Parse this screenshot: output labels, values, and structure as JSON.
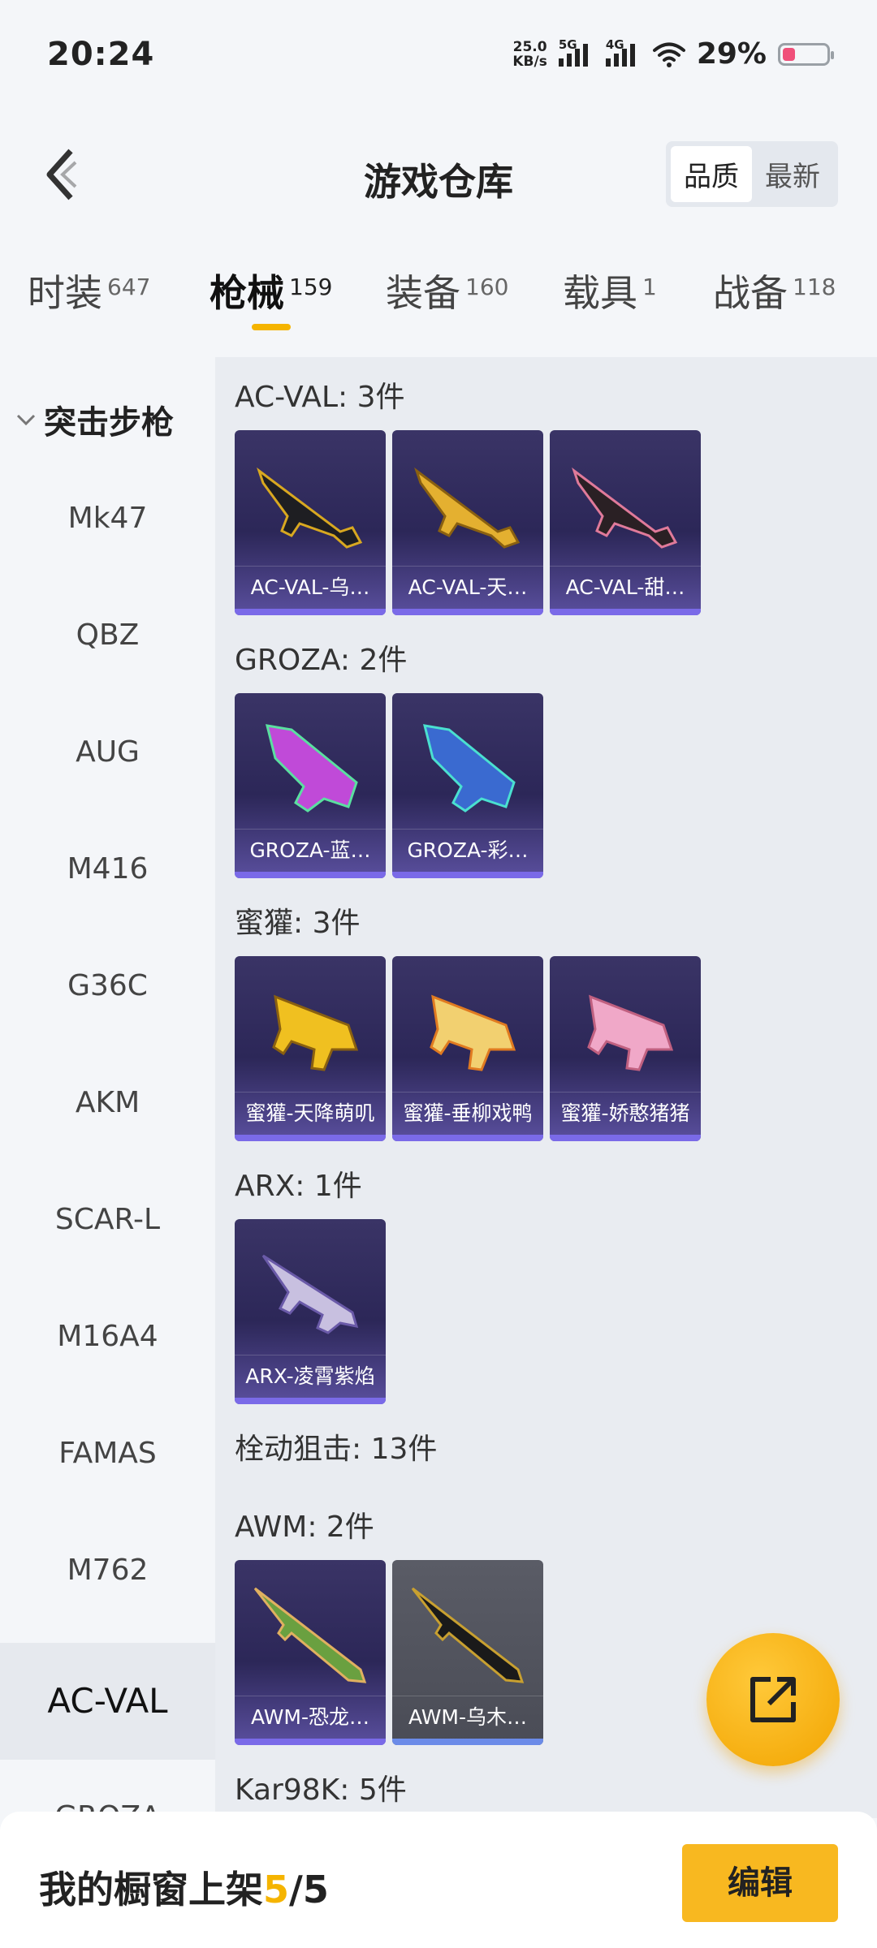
{
  "status_bar": {
    "time": "20:24",
    "net_speed_value": "25.0",
    "net_speed_unit": "KB/s",
    "sim1": "5G",
    "sim2": "4G",
    "battery_pct": "29%",
    "battery_level": 0.29
  },
  "header": {
    "title": "游戏仓库",
    "sort": [
      "品质",
      "最新"
    ],
    "sort_active": "品质"
  },
  "tabs": [
    {
      "label": "时装",
      "count": "647"
    },
    {
      "label": "枪械",
      "count": "159"
    },
    {
      "label": "装备",
      "count": "160"
    },
    {
      "label": "载具",
      "count": "1"
    },
    {
      "label": "战备",
      "count": "118"
    }
  ],
  "sidebar": {
    "group": "突击步枪",
    "items": [
      "Mk47",
      "QBZ",
      "AUG",
      "M416",
      "G36C",
      "AKM",
      "SCAR-L",
      "M16A4",
      "FAMAS",
      "M762",
      "AC-VAL",
      "GROZA"
    ],
    "active": "AC-VAL"
  },
  "sections": [
    {
      "title": "AC-VAL: 3件",
      "items": [
        "AC-VAL-乌…",
        "AC-VAL-天…",
        "AC-VAL-甜…"
      ]
    },
    {
      "title": "GROZA: 2件",
      "items": [
        "GROZA-蓝…",
        "GROZA-彩…"
      ]
    },
    {
      "title": "蜜獾: 3件",
      "items": [
        "蜜獾-天降萌叽",
        "蜜獾-垂柳戏鸭",
        "蜜獾-娇憨猪猪"
      ]
    },
    {
      "title": "ARX: 1件",
      "items": [
        "ARX-凌霄紫焰"
      ]
    },
    {
      "title": "栓动狙击: 13件"
    },
    {
      "title": "AWM: 2件",
      "items": [
        "AWM-恐龙…",
        "AWM-乌木…"
      ]
    },
    {
      "title": "Kar98K: 5件"
    }
  ],
  "bottom_bar": {
    "label": "我的橱窗上架",
    "current": "5",
    "sep": "/",
    "total": "5",
    "edit_button": "编辑"
  },
  "colors": {
    "accent": "#f5b400",
    "card_bg": "#2c2758",
    "card_bar": "#7a6ae8"
  }
}
